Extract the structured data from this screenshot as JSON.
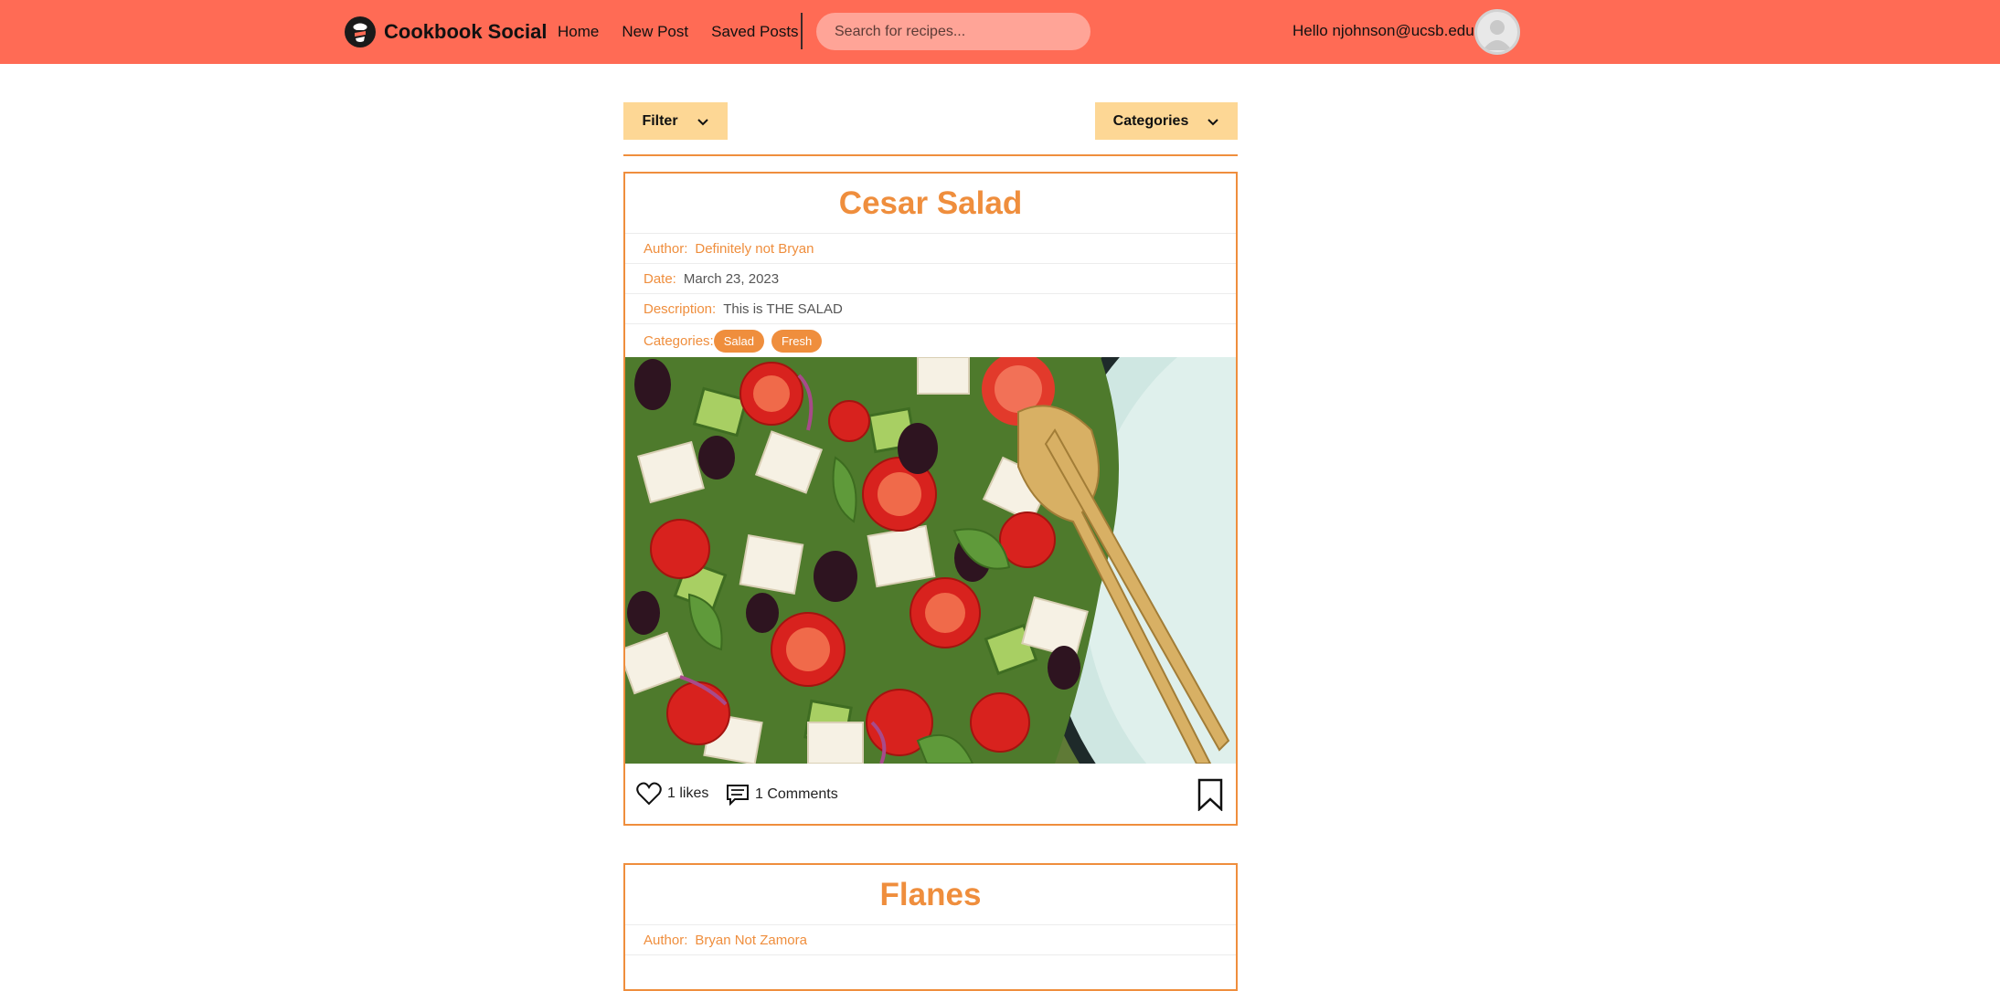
{
  "app": {
    "brand": "Cookbook Social",
    "nav": [
      "Home",
      "New Post",
      "Saved Posts"
    ],
    "search_placeholder": "Search for recipes...",
    "greeting": "Hello njohnson@ucsb.edu!"
  },
  "toolbar": {
    "filter_label": "Filter",
    "categories_label": "Categories"
  },
  "labels": {
    "author": "Author:",
    "date": "Date:",
    "description": "Description:",
    "categories": "Categories:"
  },
  "posts": [
    {
      "title": "Cesar Salad",
      "author": "Definitely not Bryan",
      "date": "March 23, 2023",
      "description": "This is THE SALAD",
      "categories": [
        "Salad",
        "Fresh"
      ],
      "likes": "1 likes",
      "comments": "1 Comments"
    },
    {
      "title": "Flanes",
      "author": "Bryan Not Zamora"
    }
  ],
  "colors": {
    "navbar": "#ff6b55",
    "accent": "#ef8e3d",
    "dropdown": "#fdd795",
    "search": "#ffa497"
  },
  "icons": {
    "brand": "chef-logo-icon",
    "avatar": "user-avatar-icon",
    "chevron": "chevron-down-icon",
    "like": "heart-outline-icon",
    "comment": "comment-bubble-icon",
    "bookmark": "bookmark-outline-icon"
  }
}
